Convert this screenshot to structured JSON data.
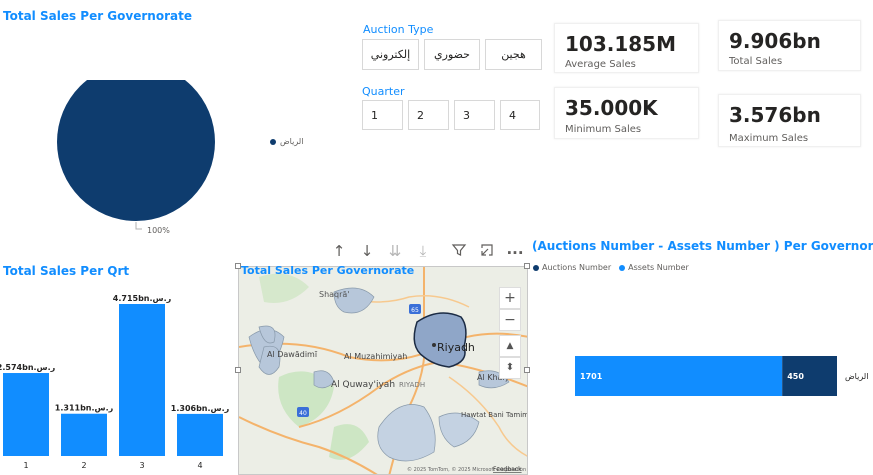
{
  "pie_section": {
    "title": "Total Sales Per Governorate",
    "slice_label": "100%",
    "legend_label": "الرياض",
    "color": "#0E3C6E"
  },
  "auction_slicer": {
    "title": "Auction Type",
    "options": [
      "إلكتروني",
      "حضوري",
      "هجين"
    ]
  },
  "quarter_slicer": {
    "title": "Quarter",
    "options": [
      "1",
      "2",
      "3",
      "4"
    ]
  },
  "cards": {
    "average": {
      "value": "103.185M",
      "label": "Average Sales"
    },
    "total": {
      "value": "9.906bn",
      "label": "Total Sales"
    },
    "minimum": {
      "value": "35.000K",
      "label": "Minimum Sales"
    },
    "maximum": {
      "value": "3.576bn",
      "label": "Maximum Sales"
    }
  },
  "qtr_section": {
    "title": "Total Sales Per Qrt",
    "color": "#118DFF"
  },
  "map_section": {
    "title": "Total Sales Per Governorate",
    "places": [
      "Shaqrā'",
      "Al Dawādimī",
      "Al Muzahimiyah",
      "Riyadh",
      "Al Quway'iyah",
      "RIYADH",
      "Al Kharj",
      "Hawtat Bani Tamim"
    ],
    "road_shields": [
      "65",
      "40"
    ],
    "attribution": "© 2025 TomTom, © 2025 Microsoft Corporation",
    "feedback_label": "Feedback"
  },
  "toolbar": {
    "icons": [
      "arrow-up-icon",
      "arrow-down-icon",
      "double-arrow-down-icon",
      "expand-hierarchy-icon",
      "filter-icon",
      "focus-mode-icon",
      "more-options-icon"
    ],
    "more_label": "..."
  },
  "auctions_section": {
    "title": "(Auctions Number - Assets Number ) Per Governorate)",
    "legend": [
      {
        "label": "Auctions Number",
        "color": "#0E3C6E"
      },
      {
        "label": "Assets Number",
        "color": "#118DFF"
      }
    ],
    "category_label": "الرياض"
  },
  "chart_data": [
    {
      "type": "pie",
      "title": "Total Sales Per Governorate",
      "categories": [
        "الرياض"
      ],
      "values": [
        100
      ],
      "data_labels": [
        "100%"
      ]
    },
    {
      "type": "bar",
      "title": "Total Sales Per Qrt",
      "categories": [
        "1",
        "2",
        "3",
        "4"
      ],
      "values": [
        2.574,
        1.311,
        4.715,
        1.306
      ],
      "data_labels": [
        "2.574bn.ر.س",
        "1.311bn.ر.س",
        "4.715bn.ر.س",
        "1.306bn.ر.س"
      ],
      "ylim": [
        0,
        5
      ]
    },
    {
      "type": "bar",
      "orientation": "horizontal-stacked",
      "title": "(Auctions Number - Assets Number ) Per Governorate)",
      "categories": [
        "الرياض"
      ],
      "series": [
        {
          "name": "Assets Number",
          "values": [
            1701
          ]
        },
        {
          "name": "Auctions Number",
          "values": [
            450
          ]
        }
      ],
      "xlim": [
        0,
        2151
      ]
    }
  ]
}
